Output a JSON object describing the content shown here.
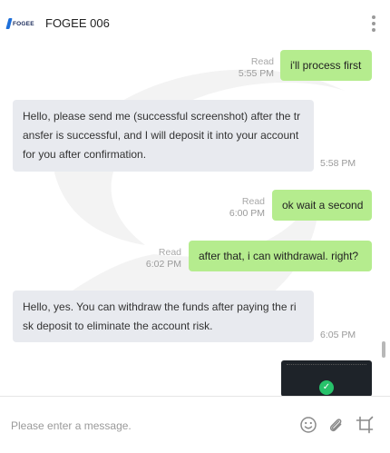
{
  "header": {
    "logo_text": "FOGEE",
    "title": "FOGEE 006"
  },
  "messages": [
    {
      "direction": "outgoing",
      "text": "i'll process first",
      "status": "Read",
      "time": "5:55 PM"
    },
    {
      "direction": "incoming",
      "text": "Hello, please send me (successful screenshot) after the tr ansfer is successful, and I will deposit it into your account for you after confirmation.",
      "time": "5:58 PM"
    },
    {
      "direction": "outgoing",
      "text": "ok wait a second",
      "status": "Read",
      "time": "6:00 PM"
    },
    {
      "direction": "outgoing",
      "text": "after that, i can withdrawal. right?",
      "status": "Read",
      "time": "6:02 PM"
    },
    {
      "direction": "incoming",
      "text": "Hello, yes. You can withdraw the funds after paying the ri sk deposit to eliminate the account risk.",
      "time": "6:05 PM"
    }
  ],
  "composer": {
    "placeholder": "Please enter a message.",
    "icons": [
      "emoji-icon",
      "paperclip-icon",
      "crop-icon"
    ]
  },
  "colors": {
    "outgoing_bubble": "#b5ec8e",
    "incoming_bubble": "#e8eaef",
    "brand_blue": "#1e6fd9"
  }
}
